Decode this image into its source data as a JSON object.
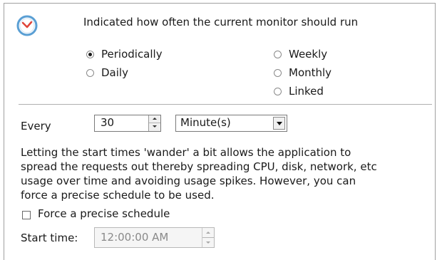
{
  "header": {
    "description": "Indicated how often the current monitor should run",
    "icon": "clock-icon",
    "icon_color": "#e0453a",
    "icon_ring_color": "#5a9fd4"
  },
  "frequency": {
    "options": [
      {
        "label": "Periodically",
        "selected": true
      },
      {
        "label": "Daily",
        "selected": false
      },
      {
        "label": "Weekly",
        "selected": false
      },
      {
        "label": "Monthly",
        "selected": false
      },
      {
        "label": "Linked",
        "selected": false
      }
    ]
  },
  "interval": {
    "label": "Every",
    "value": "30",
    "unit": "Minute(s)"
  },
  "wander": {
    "lines": [
      "Letting the start times 'wander' a bit allows the application to",
      "spread the requests out thereby spreading CPU, disk, network, etc",
      "usage over time and avoiding usage spikes.  However, you can",
      "force a precise schedule to be used."
    ]
  },
  "precise": {
    "checkbox_label": "Force a precise schedule",
    "checked": false,
    "start_label": "Start time:",
    "start_value": "12:00:00 AM"
  }
}
